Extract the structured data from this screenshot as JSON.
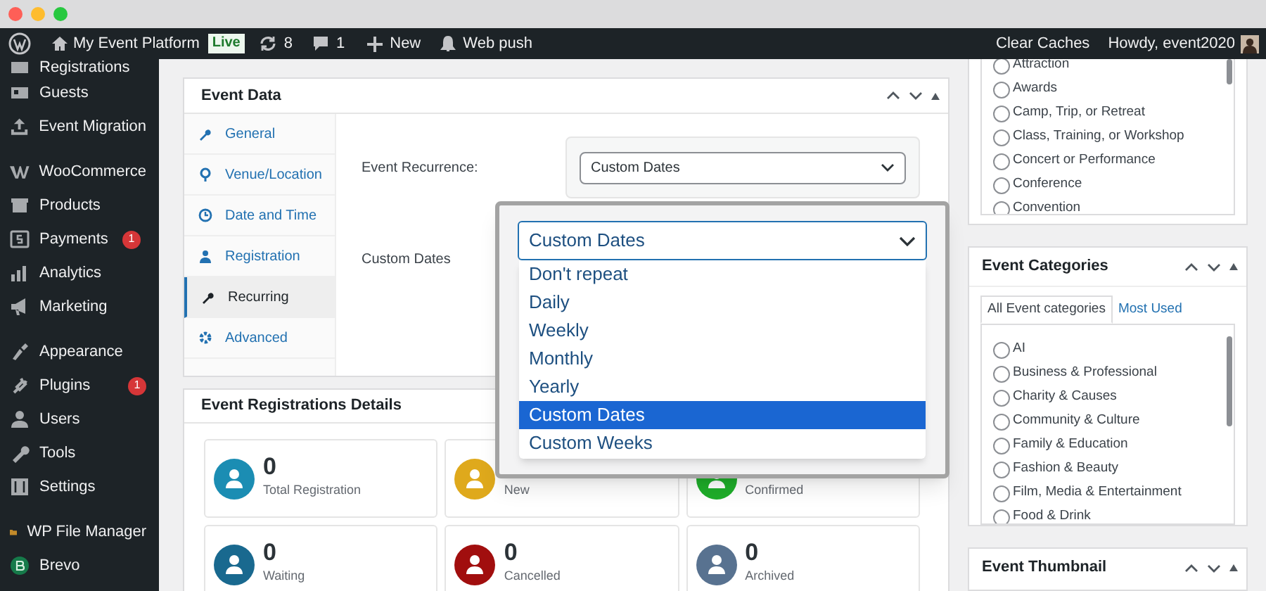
{
  "admin_bar": {
    "site": "My Event Platform",
    "live_badge": "Live",
    "updates": "8",
    "comments": "1",
    "new": "New",
    "web_push": "Web push",
    "clear_caches": "Clear Caches",
    "howdy": "Howdy, event2020"
  },
  "sidebar": {
    "groups": [
      {
        "items": [
          {
            "label": "Registrations"
          },
          {
            "label": "Guests"
          },
          {
            "label": "Event Migration"
          }
        ]
      },
      {
        "items": [
          {
            "label": "WooCommerce"
          },
          {
            "label": "Products"
          },
          {
            "label": "Payments",
            "badge": "1"
          },
          {
            "label": "Analytics"
          },
          {
            "label": "Marketing"
          }
        ]
      },
      {
        "items": [
          {
            "label": "Appearance"
          },
          {
            "label": "Plugins",
            "badge": "1"
          },
          {
            "label": "Users"
          },
          {
            "label": "Tools"
          },
          {
            "label": "Settings"
          }
        ]
      },
      {
        "items": [
          {
            "label": "WP File Manager"
          },
          {
            "label": "Brevo"
          }
        ]
      }
    ]
  },
  "event_data": {
    "title": "Event Data",
    "tabs": [
      {
        "label": "General",
        "selected": false
      },
      {
        "label": "Venue/Location",
        "selected": false
      },
      {
        "label": "Date and Time",
        "selected": false
      },
      {
        "label": "Registration",
        "selected": false
      },
      {
        "label": "Recurring",
        "selected": true
      },
      {
        "label": "Advanced",
        "selected": false
      }
    ],
    "recurrence_label": "Event Recurrence:",
    "recurrence_value": "Custom Dates",
    "custom_dates_label": "Custom Dates"
  },
  "dropdown": {
    "value": "Custom Dates",
    "options": [
      {
        "label": "Don't repeat",
        "selected": false
      },
      {
        "label": "Daily",
        "selected": false
      },
      {
        "label": "Weekly",
        "selected": false
      },
      {
        "label": "Monthly",
        "selected": false
      },
      {
        "label": "Yearly",
        "selected": false
      },
      {
        "label": "Custom Dates",
        "selected": true
      },
      {
        "label": "Custom Weeks",
        "selected": false
      }
    ]
  },
  "registrations": {
    "title": "Event Registrations Details",
    "cards": [
      {
        "count": "0",
        "label": "Total Registration",
        "color": "#1b8db3"
      },
      {
        "label": "New",
        "color": "#dfa91c"
      },
      {
        "label": "Confirmed",
        "color": "#1fae2a"
      },
      {
        "count": "0",
        "label": "Waiting",
        "color": "#19698f"
      },
      {
        "count": "0",
        "label": "Cancelled",
        "color": "#a10e0e"
      },
      {
        "count": "0",
        "label": "Archived",
        "color": "#587290"
      }
    ]
  },
  "types_box": {
    "items": [
      {
        "label": "Attraction",
        "checked": false
      },
      {
        "label": "Awards",
        "checked": false
      },
      {
        "label": "Camp, Trip, or Retreat",
        "checked": false
      },
      {
        "label": "Class, Training, or Workshop",
        "checked": false
      },
      {
        "label": "Concert or Performance",
        "checked": false
      },
      {
        "label": "Conference",
        "checked": false
      },
      {
        "label": "Convention",
        "checked": false
      }
    ]
  },
  "categories_box": {
    "title": "Event Categories",
    "tabs": [
      {
        "label": "All Event categories",
        "selected": true
      },
      {
        "label": "Most Used",
        "selected": false
      }
    ],
    "items": [
      {
        "label": "AI",
        "checked": false
      },
      {
        "label": "Business & Professional",
        "checked": false
      },
      {
        "label": "Charity & Causes",
        "checked": false
      },
      {
        "label": "Community & Culture",
        "checked": false
      },
      {
        "label": "Family & Education",
        "checked": false
      },
      {
        "label": "Fashion & Beauty",
        "checked": false
      },
      {
        "label": "Film, Media & Entertainment",
        "checked": false
      },
      {
        "label": "Food & Drink",
        "checked": false
      }
    ]
  },
  "thumbnail_box": {
    "title": "Event Thumbnail"
  }
}
